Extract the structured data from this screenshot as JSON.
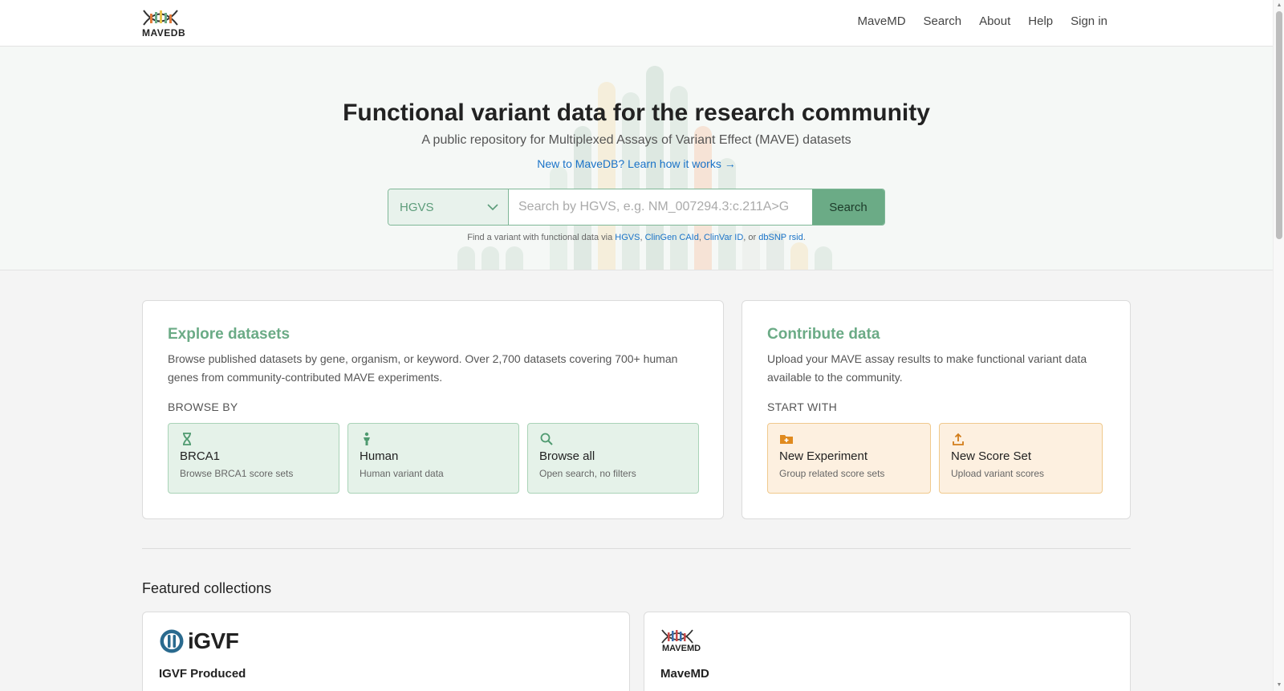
{
  "header": {
    "logo_text": "MAVEDB",
    "nav": [
      "MaveMD",
      "Search",
      "About",
      "Help",
      "Sign in"
    ]
  },
  "hero": {
    "title": "Functional variant data for the research community",
    "subtitle": "A public repository for Multiplexed Assays of Variant Effect (MAVE) datasets",
    "learn_link": "New to MaveDB? Learn how it works →",
    "search": {
      "type_selected": "HGVS",
      "placeholder": "Search by HGVS, e.g. NM_007294.3:c.211A>G",
      "button": "Search"
    },
    "hint": {
      "prefix": "Find a variant with functional data via",
      "hgvs": "HGVS",
      "clingen": "ClinGen CAId",
      "clinvar": "ClinVar ID",
      "or": "or",
      "dbsnp": "dbSNP rsid"
    }
  },
  "explore": {
    "title": "Explore datasets",
    "desc_line1": "Browse published datasets by gene, organism, or keyword. Over 2,700 datasets covering 700+ human",
    "desc_line2": "genes from community-contributed MAVE experiments.",
    "label": "BROWSE BY",
    "tiles": [
      {
        "title": "BRCA1",
        "sub": "Browse BRCA1 score sets",
        "icon": "dna-icon"
      },
      {
        "title": "Human",
        "sub": "Human variant data",
        "icon": "person-icon"
      },
      {
        "title": "Browse all",
        "sub": "Open search, no filters",
        "icon": "search-icon"
      }
    ]
  },
  "contribute": {
    "title": "Contribute data",
    "desc_line1": "Upload your MAVE assay results to make functional variant data",
    "desc_line2": "available to the community.",
    "label": "START WITH",
    "tiles": [
      {
        "title": "New Experiment",
        "sub": "Group related score sets",
        "icon": "folder-plus-icon"
      },
      {
        "title": "New Score Set",
        "sub": "Upload variant scores",
        "icon": "upload-icon"
      }
    ]
  },
  "featured": {
    "title": "Featured collections",
    "items": [
      {
        "name": "IGVF Produced",
        "logo_text": "iGVF"
      },
      {
        "name": "MaveMD",
        "logo_text": "MAVEMD"
      }
    ]
  },
  "colors": {
    "accent_green": "#6bab86",
    "link_blue": "#1a73c8",
    "orange_tile": "#fdf0e0",
    "green_tile": "#e5f2e9"
  }
}
